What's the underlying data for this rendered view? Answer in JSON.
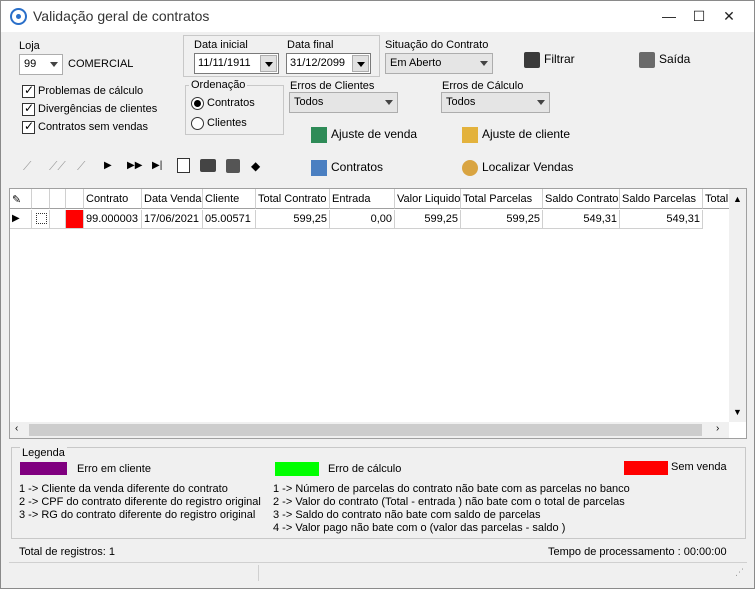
{
  "window": {
    "title": "Validação geral de contratos",
    "min": "—",
    "max": "☐",
    "close": "✕"
  },
  "loja": {
    "label": "Loja",
    "value": "99",
    "name": "COMERCIAL"
  },
  "filters": {
    "problemas": "Problemas de cálculo",
    "divergencias": "Divergências de clientes",
    "sem_vendas": "Contratos sem vendas"
  },
  "dates": {
    "inicial_label": "Data inicial",
    "inicial_value": "11/11/1911",
    "final_label": "Data final",
    "final_value": "31/12/2099"
  },
  "situacao": {
    "label": "Situação do Contrato",
    "value": "Em Aberto"
  },
  "ordenacao": {
    "label": "Ordenação",
    "contratos": "Contratos",
    "clientes": "Clientes"
  },
  "erros_clientes": {
    "label": "Erros de Clientes",
    "value": "Todos"
  },
  "erros_calculo": {
    "label": "Erros de Cálculo",
    "value": "Todos"
  },
  "buttons": {
    "filtrar": "Filtrar",
    "saida": "Saída",
    "ajuste_venda": "Ajuste de venda",
    "ajuste_cliente": "Ajuste de cliente",
    "contratos": "Contratos",
    "localizar": "Localizar Vendas"
  },
  "grid": {
    "headers": [
      "Contrato",
      "Data Venda",
      "Cliente",
      "Total Contrato",
      "Entrada",
      "Valor Liquido",
      "Total Parcelas",
      "Saldo Contrato",
      "Saldo Parcelas",
      "Total"
    ],
    "row": [
      "99.000003",
      "17/06/2021",
      "05.00571",
      "599,25",
      "0,00",
      "599,25",
      "599,25",
      "549,31",
      "549,31"
    ]
  },
  "legend": {
    "title": "Legenda",
    "erro_cliente": "Erro em cliente",
    "erro_calculo": "Erro de cálculo",
    "sem_venda": "Sem venda",
    "colors": {
      "cliente": "#800080",
      "calculo": "#00ff00",
      "venda": "#ff0000"
    },
    "left": [
      "1 -> Cliente da venda diferente do contrato",
      "2 -> CPF do contrato diferente do registro original",
      "3 -> RG do contrato diferente do registro original"
    ],
    "right": [
      "1 ->   Número de parcelas do contrato não bate com as parcelas no banco",
      "2 ->   Valor do contrato (Total - entrada ) não bate com o total de parcelas",
      "3 ->   Saldo do contrato não bate com saldo de parcelas",
      "4 ->   Valor pago não bate com o (valor das parcelas - saldo )"
    ]
  },
  "footer": {
    "total": "Total de registros: 1",
    "tempo": "Tempo de processamento : 00:00:00"
  }
}
